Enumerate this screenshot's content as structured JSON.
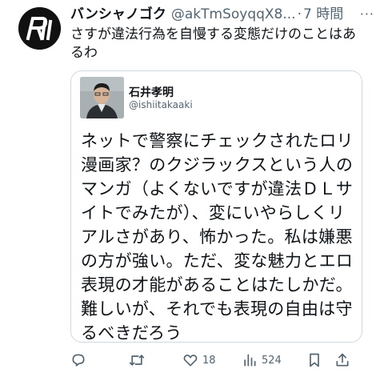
{
  "tweet": {
    "display_name": "バンシャノゴク",
    "handle": "@akTmSoyqqX8...",
    "separator": "·",
    "time": "7 時間",
    "more": "···",
    "text": "さすが違法行為を自慢する変態だけのことはあるわ"
  },
  "quote": {
    "display_name": "石井孝明",
    "handle": "@ishiitakaaki",
    "text": "ネットで警察にチェックされたロリ漫画家？のクジラックスという人のマンガ（よくないですが違法ＤＬサイトでみたが）、変にいやらしくリアルさがあり、怖かった。私は嫌悪の方が強い。ただ、変な魅力とエロ表現の才能があることはたしかだ。難しいが、それでも表現の自由は守るべきだろう"
  },
  "actions": {
    "reply_icon": "reply-icon",
    "retweet_icon": "retweet-icon",
    "like_icon": "heart-icon",
    "like_count": "18",
    "views_icon": "views-icon",
    "views_count": "524",
    "bookmark_icon": "bookmark-icon",
    "share_icon": "share-icon"
  },
  "colors": {
    "text": "#0f1419",
    "secondary": "#536471",
    "border": "#cfd9de"
  }
}
